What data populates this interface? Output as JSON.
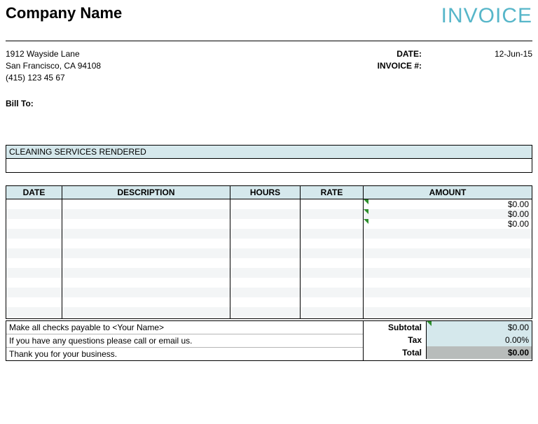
{
  "header": {
    "company": "Company Name",
    "title": "INVOICE"
  },
  "address": {
    "line1": "1912 Wayside Lane",
    "line2": "San Francisco, CA 94108",
    "phone": "(415) 123 45 67"
  },
  "meta": {
    "date_label": "DATE:",
    "invoice_label": "INVOICE #:",
    "date_value": "12-Jun-15",
    "invoice_value": ""
  },
  "billto_label": "Bill To:",
  "section_title": "CLEANING SERVICES RENDERED",
  "columns": {
    "date": "DATE",
    "desc": "DESCRIPTION",
    "hours": "HOURS",
    "rate": "RATE",
    "amount": "AMOUNT"
  },
  "amounts": [
    "$0.00",
    "$0.00",
    "$0.00"
  ],
  "footer_lines": {
    "l1": "Make all checks payable to <Your Name>",
    "l2": "If you have any questions please call or email us.",
    "l3": "Thank  you for your business."
  },
  "totals": {
    "subtotal_label": "Subtotal",
    "subtotal_value": "$0.00",
    "tax_label": "Tax",
    "tax_value": "0.00%",
    "total_label": "Total",
    "total_value": "$0.00"
  }
}
